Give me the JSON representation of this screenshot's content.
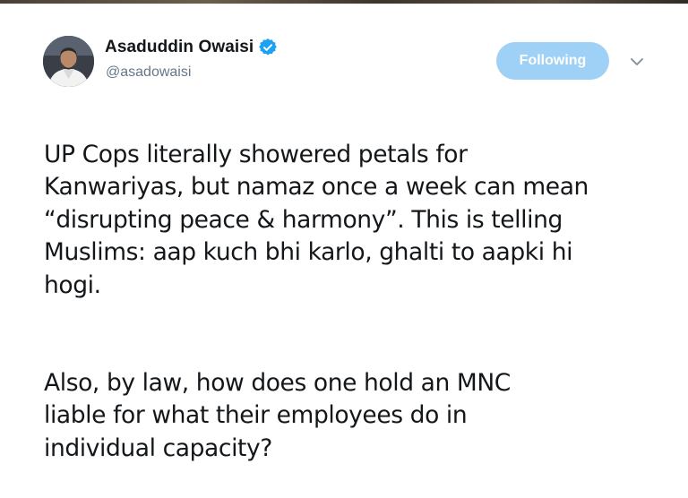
{
  "tweet": {
    "author": {
      "display_name": "Asaduddin Owaisi",
      "handle": "@asadowaisi",
      "verified": true,
      "verified_color": "#1da1f2"
    },
    "follow_button": {
      "label": "Following",
      "color": "#9fd0f5"
    },
    "menu_icon": "chevron-down-icon",
    "paragraphs": [
      "UP Cops literally showered petals for\nKanwariyas, but namaz once a week can mean\n“disrupting peace & harmony”. This is telling\nMuslims: aap kuch bhi karlo, ghalti to aapki hi\nhogi.",
      "Also, by law, how does one hold an MNC\nliable for what their employees do in\nindividual capacity?"
    ]
  }
}
